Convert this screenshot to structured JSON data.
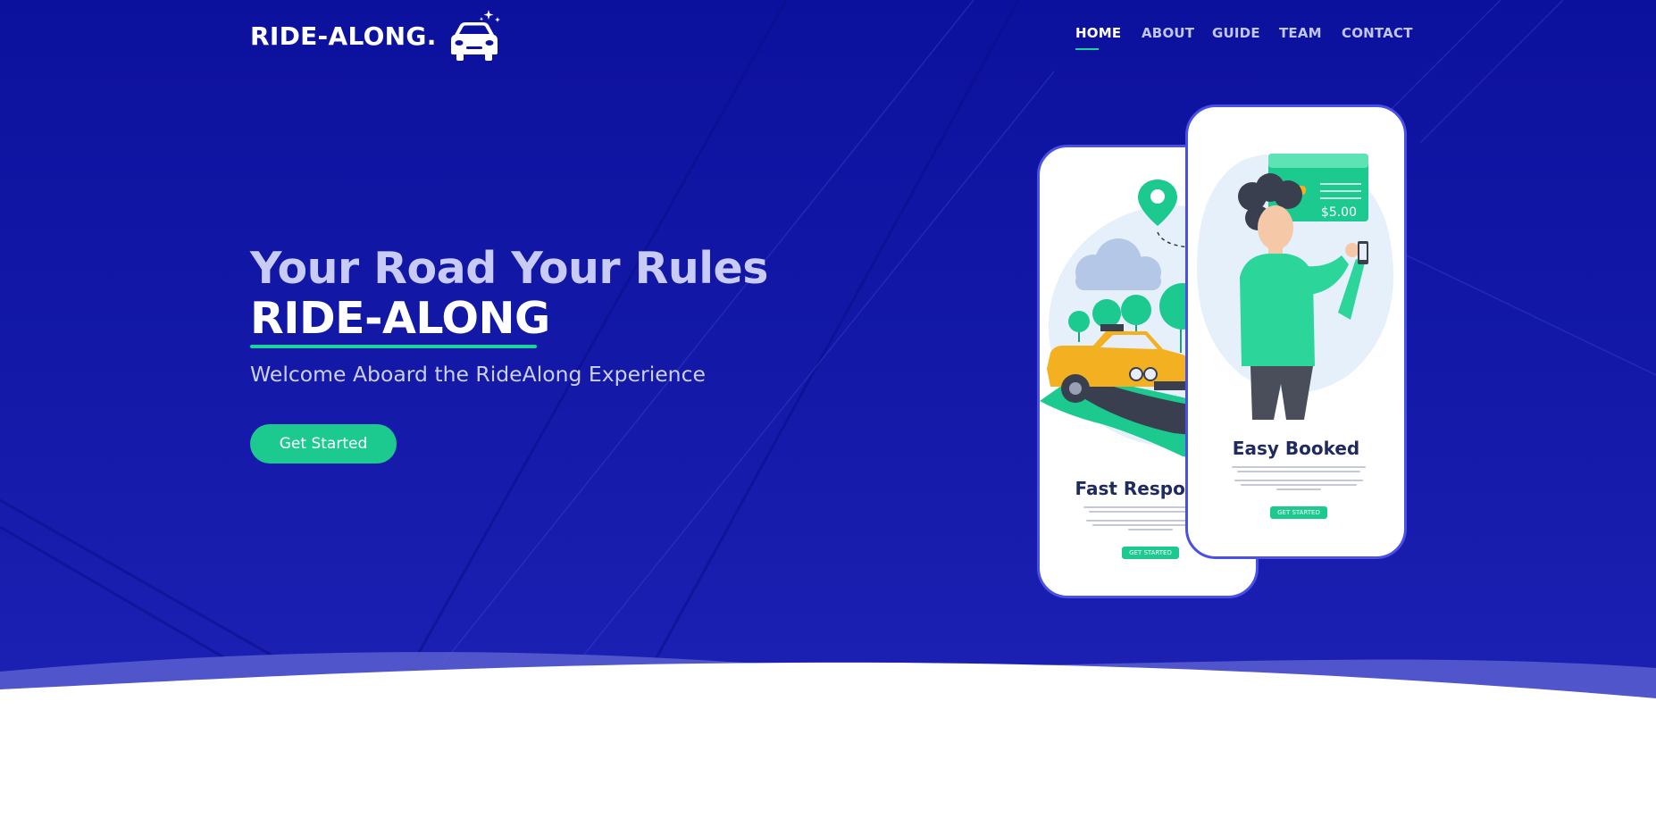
{
  "brand": {
    "name": "RIDE-ALONG.",
    "car_icon": "car-with-sparkles-icon"
  },
  "nav": {
    "items": [
      {
        "label": "HOME",
        "active": true
      },
      {
        "label": "ABOUT",
        "active": false
      },
      {
        "label": "GUIDE",
        "active": false
      },
      {
        "label": "TEAM",
        "active": false
      },
      {
        "label": "CONTACT",
        "active": false
      }
    ]
  },
  "hero": {
    "title": "Your Road Your Rules",
    "brand": "RIDE-ALONG",
    "subtitle": "Welcome Aboard the RideAlong Experience",
    "cta_label": "Get Started"
  },
  "phones": {
    "back": {
      "title": "Fast Response",
      "button": "GET STARTED",
      "illustration": "taxi-map-illustration"
    },
    "front": {
      "title": "Easy Booked",
      "button": "GET STARTED",
      "price": "$5.00",
      "illustration": "person-booking-illustration"
    }
  },
  "colors": {
    "hero_bg": "#0c119d",
    "accent": "#1cd39a",
    "phone_border": "#4a4fe6",
    "text_light": "#c8cbf6"
  }
}
